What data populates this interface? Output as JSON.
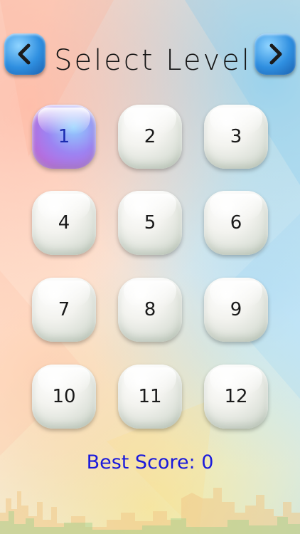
{
  "header": {
    "title": "Select Level",
    "prev_icon": "chevron-left-icon",
    "next_icon": "chevron-right-icon",
    "accent_color": "#2f8fe0"
  },
  "levels": [
    "1",
    "2",
    "3",
    "4",
    "5",
    "6",
    "7",
    "8",
    "9",
    "10",
    "11",
    "12"
  ],
  "selected_level": "1",
  "footer": {
    "best_score": "Best Score: 0",
    "score_color": "#1a1adc"
  }
}
